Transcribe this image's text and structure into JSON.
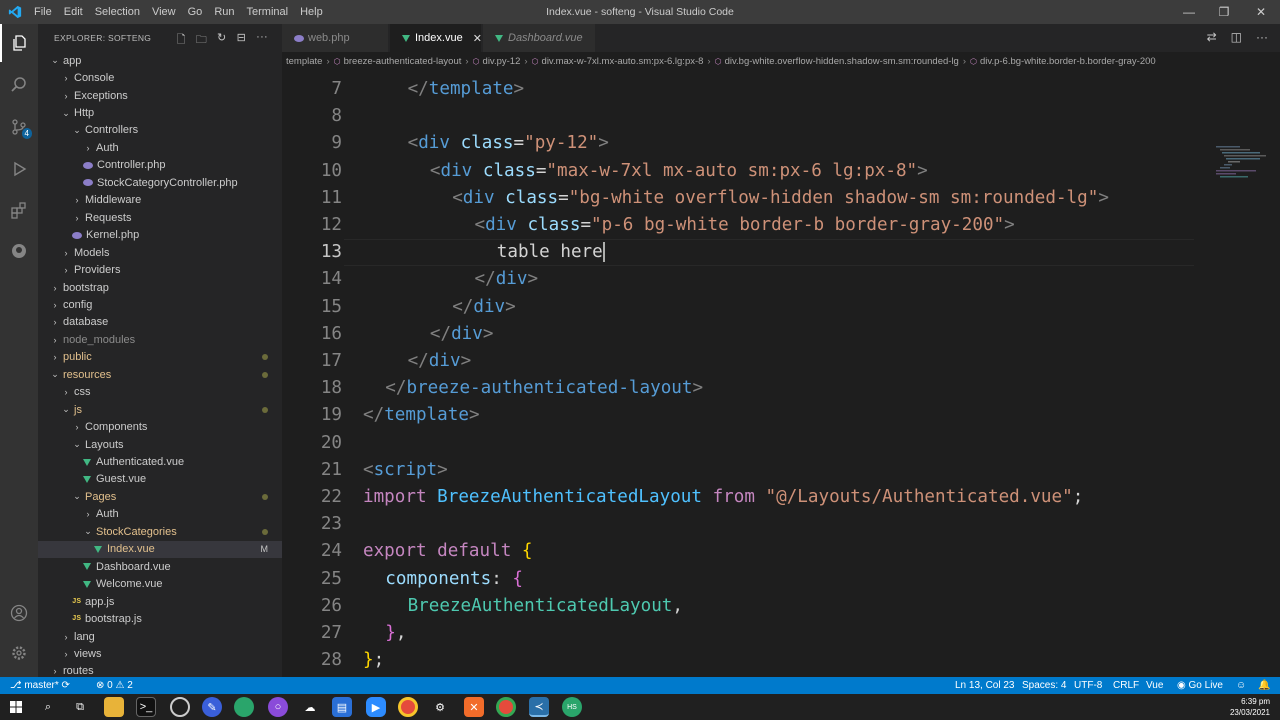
{
  "window": {
    "title": "Index.vue - softeng - Visual Studio Code"
  },
  "menu": [
    "File",
    "Edit",
    "Selection",
    "View",
    "Go",
    "Run",
    "Terminal",
    "Help"
  ],
  "activity": {
    "scm_badge": "4"
  },
  "explorer": {
    "title": "EXPLORER: SOFTENG",
    "tree": [
      {
        "label": "app",
        "depth": 0,
        "type": "folder-open"
      },
      {
        "label": "Console",
        "depth": 1,
        "type": "folder"
      },
      {
        "label": "Exceptions",
        "depth": 1,
        "type": "folder"
      },
      {
        "label": "Http",
        "depth": 1,
        "type": "folder-open"
      },
      {
        "label": "Controllers",
        "depth": 2,
        "type": "folder-open"
      },
      {
        "label": "Auth",
        "depth": 3,
        "type": "folder"
      },
      {
        "label": "Controller.php",
        "depth": 3,
        "type": "php"
      },
      {
        "label": "StockCategoryController.php",
        "depth": 3,
        "type": "php"
      },
      {
        "label": "Middleware",
        "depth": 2,
        "type": "folder"
      },
      {
        "label": "Requests",
        "depth": 2,
        "type": "folder"
      },
      {
        "label": "Kernel.php",
        "depth": 2,
        "type": "php"
      },
      {
        "label": "Models",
        "depth": 1,
        "type": "folder"
      },
      {
        "label": "Providers",
        "depth": 1,
        "type": "folder"
      },
      {
        "label": "bootstrap",
        "depth": 0,
        "type": "folder"
      },
      {
        "label": "config",
        "depth": 0,
        "type": "folder"
      },
      {
        "label": "database",
        "depth": 0,
        "type": "folder"
      },
      {
        "label": "node_modules",
        "depth": 0,
        "type": "folder",
        "dim": true
      },
      {
        "label": "public",
        "depth": 0,
        "type": "folder",
        "color": "#e2c08d",
        "dot": true
      },
      {
        "label": "resources",
        "depth": 0,
        "type": "folder-open",
        "color": "#e2c08d",
        "dot": true
      },
      {
        "label": "css",
        "depth": 1,
        "type": "folder"
      },
      {
        "label": "js",
        "depth": 1,
        "type": "folder-open",
        "color": "#e2c08d",
        "dot": true
      },
      {
        "label": "Components",
        "depth": 2,
        "type": "folder"
      },
      {
        "label": "Layouts",
        "depth": 2,
        "type": "folder-open"
      },
      {
        "label": "Authenticated.vue",
        "depth": 3,
        "type": "vue"
      },
      {
        "label": "Guest.vue",
        "depth": 3,
        "type": "vue"
      },
      {
        "label": "Pages",
        "depth": 2,
        "type": "folder-open",
        "color": "#e2c08d",
        "dot": true
      },
      {
        "label": "Auth",
        "depth": 3,
        "type": "folder"
      },
      {
        "label": "StockCategories",
        "depth": 3,
        "type": "folder-open",
        "color": "#e2c08d",
        "dot": true
      },
      {
        "label": "Index.vue",
        "depth": 4,
        "type": "vue",
        "color": "#e2c08d",
        "selected": true,
        "flag": "M"
      },
      {
        "label": "Dashboard.vue",
        "depth": 3,
        "type": "vue"
      },
      {
        "label": "Welcome.vue",
        "depth": 3,
        "type": "vue"
      },
      {
        "label": "app.js",
        "depth": 2,
        "type": "js"
      },
      {
        "label": "bootstrap.js",
        "depth": 2,
        "type": "js"
      },
      {
        "label": "lang",
        "depth": 1,
        "type": "folder"
      },
      {
        "label": "views",
        "depth": 1,
        "type": "folder"
      },
      {
        "label": "routes",
        "depth": 0,
        "type": "folder"
      }
    ]
  },
  "tabs": [
    {
      "label": "web.php",
      "icon": "php-icon",
      "active": false
    },
    {
      "label": "Index.vue",
      "icon": "vue-icon",
      "active": true
    },
    {
      "label": "Dashboard.vue",
      "icon": "vue-icon",
      "active": false,
      "italic": true
    }
  ],
  "breadcrumbs": [
    "template",
    "breeze-authenticated-layout",
    "div.py-12",
    "div.max-w-7xl.mx-auto.sm:px-6.lg:px-8",
    "div.bg-white.overflow-hidden.shadow-sm.sm:rounded-lg",
    "div.p-6.bg-white.border-b.border-gray-200"
  ],
  "editor": {
    "current_line": 13,
    "lines": [
      {
        "n": "7",
        "indent": 2,
        "tokens": [
          [
            "t-br",
            "</"
          ],
          [
            "t-tag",
            "template"
          ],
          [
            "t-br",
            ">"
          ]
        ]
      },
      {
        "n": "8",
        "indent": 0,
        "tokens": []
      },
      {
        "n": "9",
        "indent": 2,
        "tokens": [
          [
            "t-br",
            "<"
          ],
          [
            "t-tag",
            "div"
          ],
          [
            "t-txt",
            " "
          ],
          [
            "t-attr",
            "class"
          ],
          [
            "t-txt",
            "="
          ],
          [
            "t-str",
            "\"py-12\""
          ],
          [
            "t-br",
            ">"
          ]
        ]
      },
      {
        "n": "10",
        "indent": 3,
        "tokens": [
          [
            "t-br",
            "<"
          ],
          [
            "t-tag",
            "div"
          ],
          [
            "t-txt",
            " "
          ],
          [
            "t-attr",
            "class"
          ],
          [
            "t-txt",
            "="
          ],
          [
            "t-str",
            "\"max-w-7xl mx-auto sm:px-6 lg:px-8\""
          ],
          [
            "t-br",
            ">"
          ]
        ]
      },
      {
        "n": "11",
        "indent": 4,
        "tokens": [
          [
            "t-br",
            "<"
          ],
          [
            "t-tag",
            "div"
          ],
          [
            "t-txt",
            " "
          ],
          [
            "t-attr",
            "class"
          ],
          [
            "t-txt",
            "="
          ],
          [
            "t-str",
            "\"bg-white overflow-hidden shadow-sm sm:rounded-lg\""
          ],
          [
            "t-br",
            ">"
          ]
        ]
      },
      {
        "n": "12",
        "indent": 5,
        "tokens": [
          [
            "t-br",
            "<"
          ],
          [
            "t-tag",
            "div"
          ],
          [
            "t-txt",
            " "
          ],
          [
            "t-attr",
            "class"
          ],
          [
            "t-txt",
            "="
          ],
          [
            "t-str",
            "\"p-6 bg-white border-b border-gray-200\""
          ],
          [
            "t-br",
            ">"
          ]
        ]
      },
      {
        "n": "13",
        "indent": 6,
        "tokens": [
          [
            "t-txt",
            "table here"
          ]
        ],
        "cursor": true
      },
      {
        "n": "14",
        "indent": 5,
        "tokens": [
          [
            "t-br",
            "</"
          ],
          [
            "t-tag",
            "div"
          ],
          [
            "t-br",
            ">"
          ]
        ]
      },
      {
        "n": "15",
        "indent": 4,
        "tokens": [
          [
            "t-br",
            "</"
          ],
          [
            "t-tag",
            "div"
          ],
          [
            "t-br",
            ">"
          ]
        ]
      },
      {
        "n": "16",
        "indent": 3,
        "tokens": [
          [
            "t-br",
            "</"
          ],
          [
            "t-tag",
            "div"
          ],
          [
            "t-br",
            ">"
          ]
        ]
      },
      {
        "n": "17",
        "indent": 2,
        "tokens": [
          [
            "t-br",
            "</"
          ],
          [
            "t-tag",
            "div"
          ],
          [
            "t-br",
            ">"
          ]
        ]
      },
      {
        "n": "18",
        "indent": 1,
        "tokens": [
          [
            "t-br",
            "</"
          ],
          [
            "t-tag",
            "breeze-authenticated-layout"
          ],
          [
            "t-br",
            ">"
          ]
        ]
      },
      {
        "n": "19",
        "indent": 0,
        "tokens": [
          [
            "t-br",
            "</"
          ],
          [
            "t-tag",
            "template"
          ],
          [
            "t-br",
            ">"
          ]
        ]
      },
      {
        "n": "20",
        "indent": 0,
        "tokens": []
      },
      {
        "n": "21",
        "indent": 0,
        "tokens": [
          [
            "t-br",
            "<"
          ],
          [
            "t-tag",
            "script"
          ],
          [
            "t-br",
            ">"
          ]
        ]
      },
      {
        "n": "22",
        "indent": 0,
        "tokens": [
          [
            "t-kw",
            "import"
          ],
          [
            "t-txt",
            " "
          ],
          [
            "t-id",
            "BreezeAuthenticatedLayout"
          ],
          [
            "t-txt",
            " "
          ],
          [
            "t-kw",
            "from"
          ],
          [
            "t-txt",
            " "
          ],
          [
            "t-str",
            "\"@/Layouts/Authenticated.vue\""
          ],
          [
            "t-txt",
            ";"
          ]
        ]
      },
      {
        "n": "23",
        "indent": 0,
        "tokens": []
      },
      {
        "n": "24",
        "indent": 0,
        "tokens": [
          [
            "t-kw",
            "export"
          ],
          [
            "t-txt",
            " "
          ],
          [
            "t-kw",
            "default"
          ],
          [
            "t-txt",
            " "
          ],
          [
            "t-brace",
            "{"
          ]
        ]
      },
      {
        "n": "25",
        "indent": 1,
        "tokens": [
          [
            "t-prop",
            "components"
          ],
          [
            "t-txt",
            ": "
          ],
          [
            "t-brace2",
            "{"
          ]
        ]
      },
      {
        "n": "26",
        "indent": 2,
        "tokens": [
          [
            "t-cls",
            "BreezeAuthenticatedLayout"
          ],
          [
            "t-txt",
            ","
          ]
        ]
      },
      {
        "n": "27",
        "indent": 1,
        "tokens": [
          [
            "t-brace2",
            "}"
          ],
          [
            "t-txt",
            ","
          ]
        ]
      },
      {
        "n": "28",
        "indent": 0,
        "tokens": [
          [
            "t-brace",
            "}"
          ],
          [
            "t-txt",
            ";"
          ]
        ]
      }
    ]
  },
  "status": {
    "branch": "master*",
    "errors": "0",
    "warnings": "2",
    "position": "Ln 13, Col 23",
    "spaces": "Spaces: 4",
    "encoding": "UTF-8",
    "eol": "CRLF",
    "language": "Vue",
    "golive": "Go Live"
  },
  "clock": {
    "time": "6:39 pm",
    "date": "23/03/2021"
  },
  "colors": {
    "statusbar": "#007acc",
    "activity": "#333333",
    "sidebar": "#252526",
    "editor": "#1e1e1e"
  }
}
